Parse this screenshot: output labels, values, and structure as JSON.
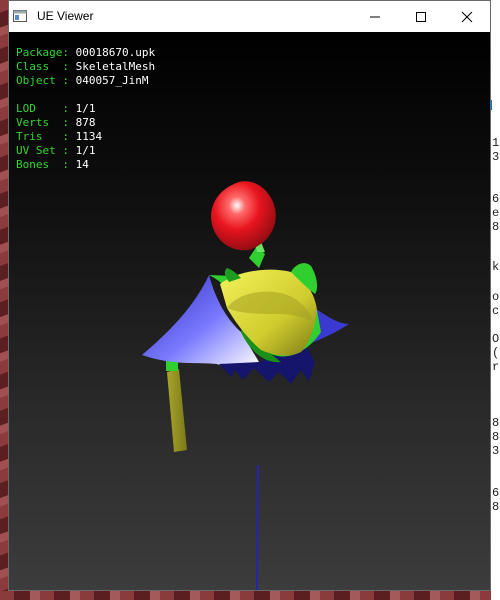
{
  "window": {
    "title": "UE Viewer"
  },
  "info": {
    "package_label": "Package:",
    "package_value": "00018670.upk",
    "class_label": "Class  :",
    "class_value": "SkeletalMesh",
    "object_label": "Object :",
    "object_value": "040057_JinM",
    "lod_label": "LOD    :",
    "lod_value": "1/1",
    "verts_label": "Verts  :",
    "verts_value": "878",
    "tris_label": "Tris   :",
    "tris_value": "1134",
    "uvset_label": "UV Set :",
    "uvset_value": "1/1",
    "bones_label": "Bones  :",
    "bones_value": "14"
  },
  "console_fragments": [
    "1",
    "3",
    "6",
    "e",
    "8",
    "k",
    "o",
    "c",
    "O",
    "(",
    "r",
    "8",
    "8",
    "3",
    "6",
    "8"
  ],
  "colors": {
    "label_green": "#33d633",
    "mesh_red": "#e8141e",
    "mesh_yellow": "#d8d63a",
    "mesh_blue": "#3b3bd8",
    "mesh_green": "#2fcf2f"
  },
  "icons": [
    "app-window-icon",
    "minimize-icon",
    "maximize-icon",
    "close-icon"
  ]
}
